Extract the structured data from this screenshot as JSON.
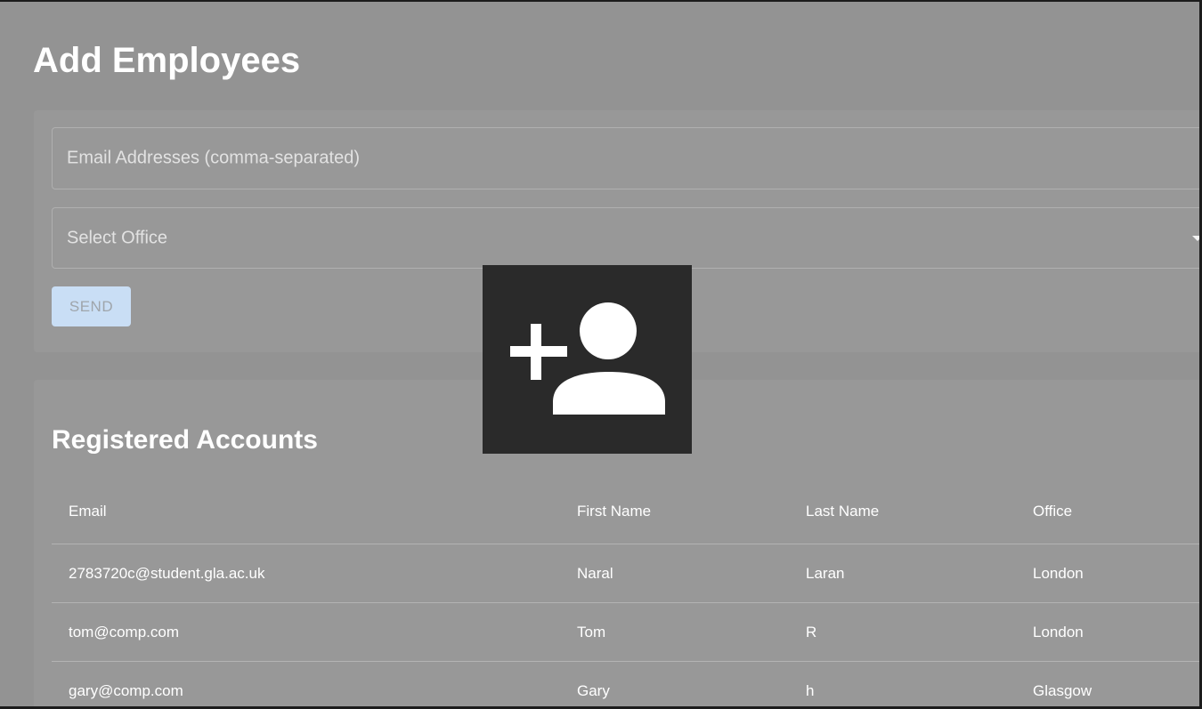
{
  "page": {
    "title": "Add Employees"
  },
  "form": {
    "email_placeholder": "Email Addresses (comma-separated)",
    "office_placeholder": "Select Office",
    "send_label": "SEND"
  },
  "accounts": {
    "title": "Registered Accounts",
    "columns": {
      "email": "Email",
      "first_name": "First Name",
      "last_name": "Last Name",
      "office": "Office"
    },
    "rows": [
      {
        "email": "2783720c@student.gla.ac.uk",
        "first_name": "Naral",
        "last_name": "Laran",
        "office": "London"
      },
      {
        "email": "tom@comp.com",
        "first_name": "Tom",
        "last_name": "R",
        "office": "London"
      },
      {
        "email": "gary@comp.com",
        "first_name": "Gary",
        "last_name": "h",
        "office": "Glasgow"
      }
    ]
  },
  "overlay": {
    "icon": "add-person-icon"
  },
  "colors": {
    "page_background": "#939393",
    "card_background": "#989898",
    "send_button": "#c9def5",
    "overlay_background": "#2a2a2a",
    "text": "#ffffff"
  }
}
